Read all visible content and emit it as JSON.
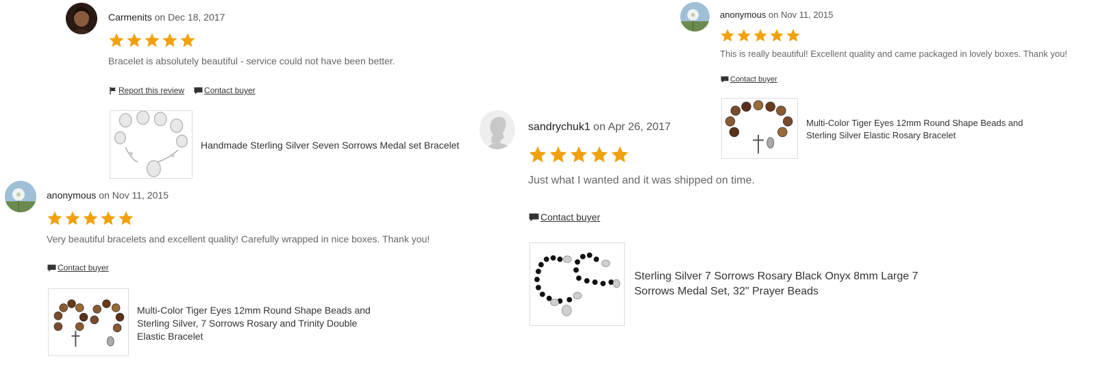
{
  "reviews": [
    {
      "author": "Carmenits",
      "date_prefix": "on",
      "date": "Dec 18, 2017",
      "rating": 5,
      "text": "Bracelet is absolutely beautiful - service could not have been better.",
      "actions": {
        "report": "Report this review",
        "contact": "Contact buyer"
      },
      "item_title": "Handmade Sterling Silver Seven Sorrows Medal set Bracelet"
    },
    {
      "author": "anonymous",
      "date_prefix": "on",
      "date": "Nov 11, 2015",
      "rating": 5,
      "text": "Very beautiful bracelets and excellent quality! Carefully wrapped in nice boxes. Thank you!",
      "actions": {
        "contact": "Contact buyer"
      },
      "item_title": "Multi-Color Tiger Eyes 12mm Round Shape Beads and Sterling Silver, 7 Sorrows Rosary and Trinity Double Elastic Bracelet"
    },
    {
      "author": "sandrychuk1",
      "date_prefix": "on",
      "date": "Apr 26, 2017",
      "rating": 5,
      "text": "Just what I wanted and it was shipped on time.",
      "actions": {
        "contact": "Contact buyer"
      },
      "item_title": "Sterling Silver 7 Sorrows Rosary Black Onyx 8mm Large 7 Sorrows Medal Set, 32\" Prayer Beads"
    },
    {
      "author": "anonymous",
      "date_prefix": "on",
      "date": "Nov 11, 2015",
      "rating": 5,
      "text": "This is really beautiful! Excellent quality and came packaged in lovely boxes. Thank you!",
      "actions": {
        "contact": "Contact buyer"
      },
      "item_title": "Multi-Color Tiger Eyes 12mm Round Shape Beads and Sterling Silver Elastic Rosary Bracelet"
    }
  ],
  "icons": {
    "star": "star-icon",
    "flag": "flag-icon",
    "message": "message-icon"
  },
  "colors": {
    "star": "#F1A10D",
    "text_muted": "#666666",
    "link": "#333333"
  }
}
